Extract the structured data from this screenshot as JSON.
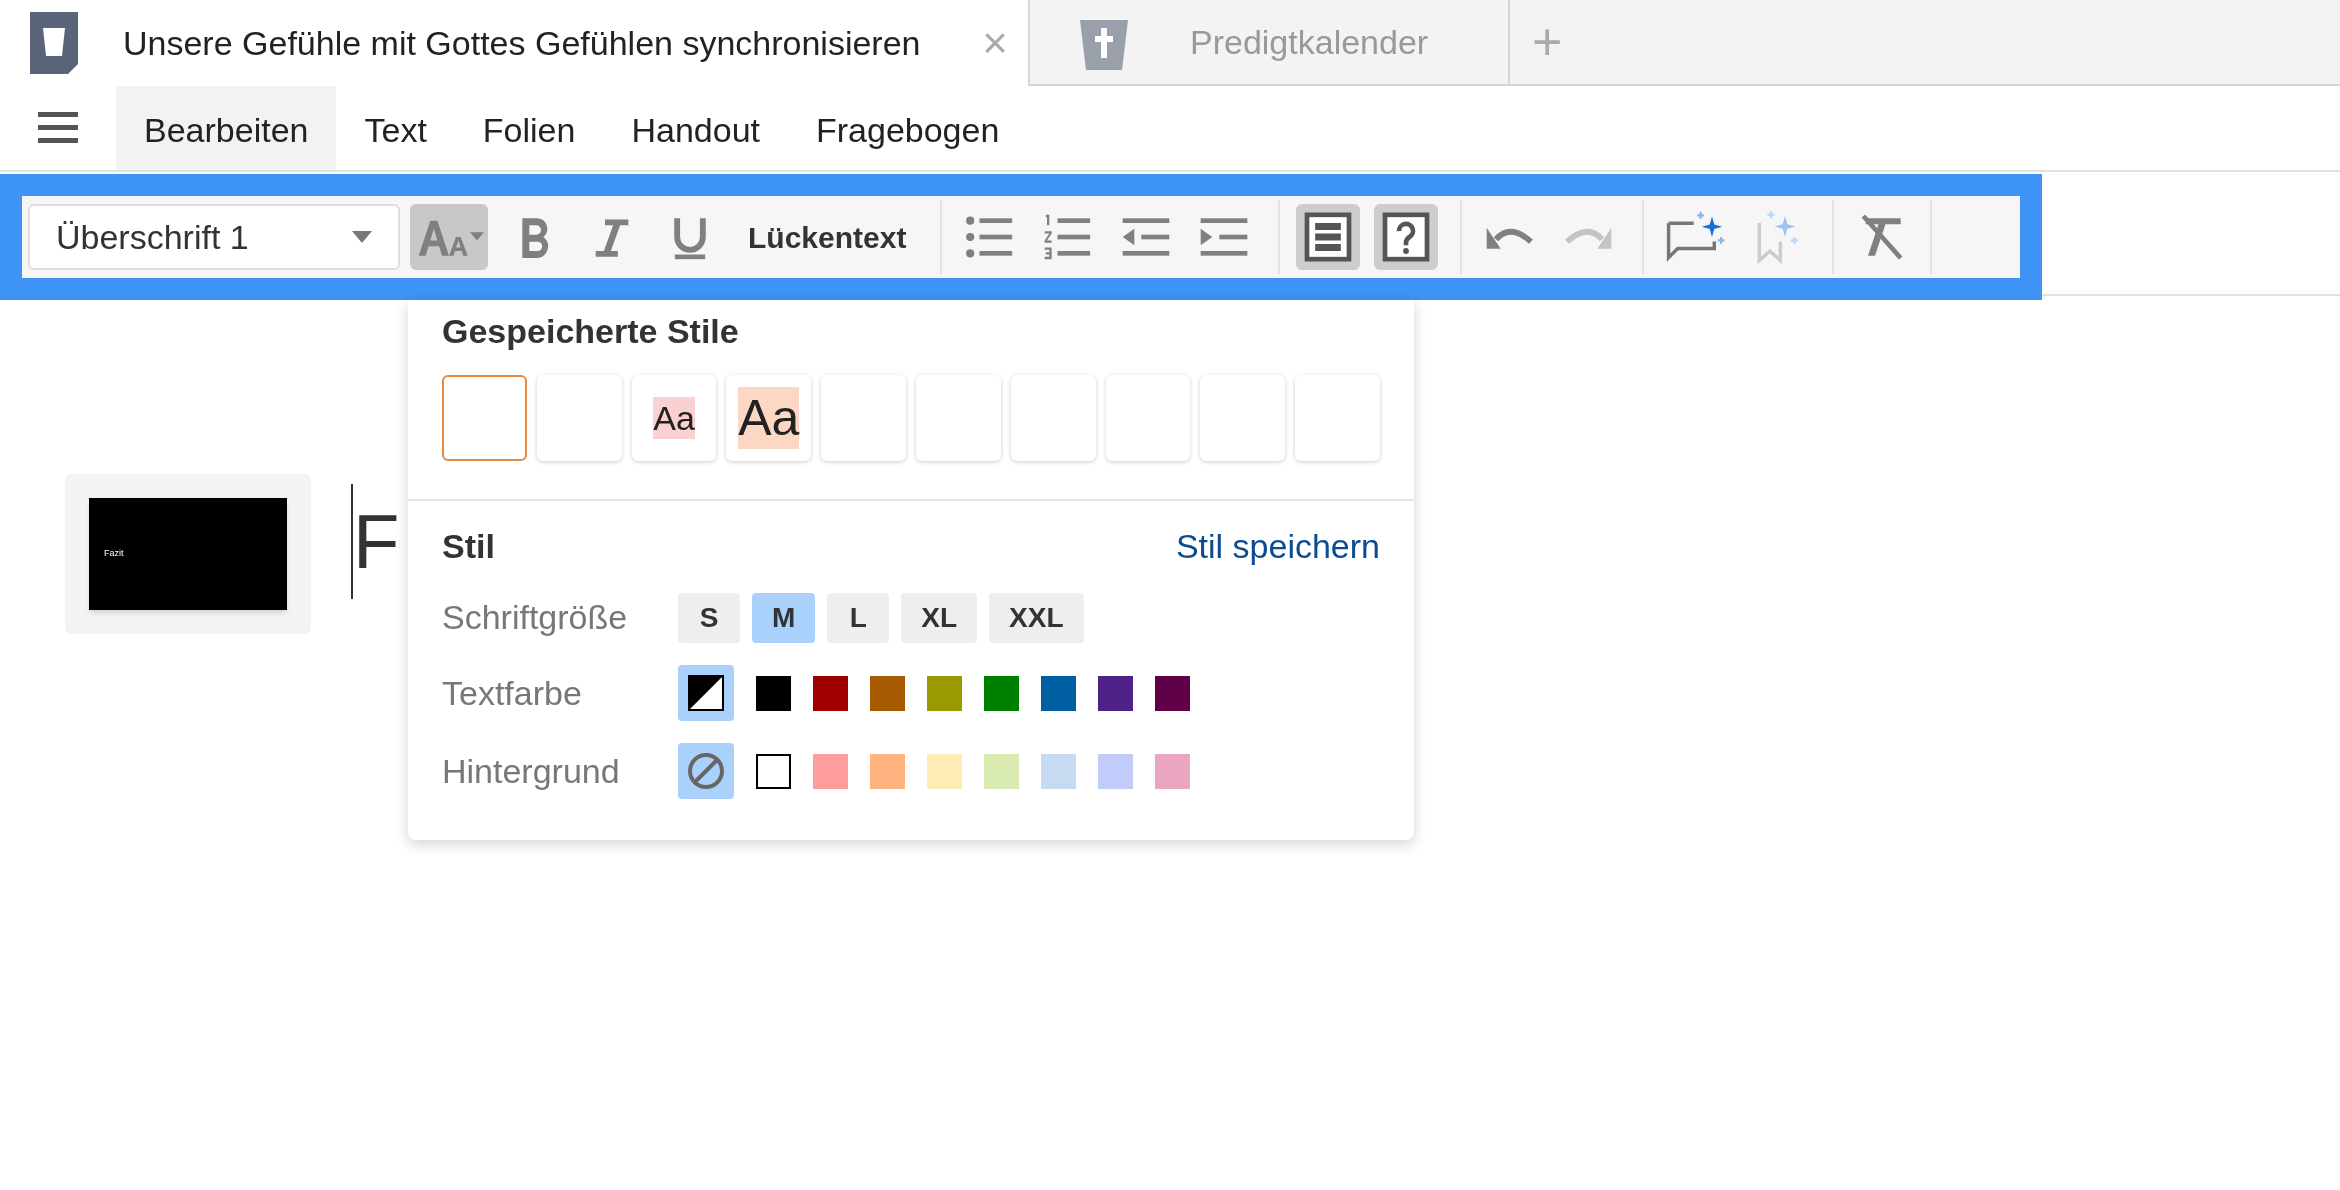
{
  "tabs": [
    {
      "title": "Unsere Gefühle mit Gottes Gefühlen synchronisieren",
      "selected": true,
      "close": "×"
    },
    {
      "title": "Predigtkalender",
      "selected": false
    }
  ],
  "new_tab": "+",
  "menu": [
    {
      "label": "Bearbeiten",
      "selected": true
    },
    {
      "label": "Text",
      "selected": false
    },
    {
      "label": "Folien",
      "selected": false
    },
    {
      "label": "Handout",
      "selected": false
    },
    {
      "label": "Fragebogen",
      "selected": false
    }
  ],
  "toolbar": {
    "paragraph_style": "Überschrift 1",
    "groups": [
      [
        {
          "kind": "font-size",
          "selected": true,
          "disabled": false
        },
        {
          "kind": "bold",
          "selected": false,
          "disabled": false
        },
        {
          "kind": "italic",
          "selected": false,
          "disabled": false
        },
        {
          "kind": "underline",
          "selected": false,
          "disabled": false
        },
        {
          "kind": "gap-text",
          "label": "Lückentext",
          "selected": false,
          "disabled": false
        }
      ],
      [
        {
          "kind": "bullet-list",
          "selected": false,
          "disabled": false
        },
        {
          "kind": "numbered-list",
          "selected": false,
          "disabled": false
        },
        {
          "kind": "outdent",
          "selected": false,
          "disabled": false
        },
        {
          "kind": "indent",
          "selected": false,
          "disabled": false
        }
      ],
      [
        {
          "kind": "text-block",
          "selected": true,
          "disabled": false
        },
        {
          "kind": "question-block",
          "selected": true,
          "disabled": false
        }
      ],
      [
        {
          "kind": "undo",
          "selected": false,
          "disabled": false
        },
        {
          "kind": "redo",
          "selected": false,
          "disabled": true
        }
      ],
      [
        {
          "kind": "ai-comment",
          "selected": false,
          "disabled": false
        },
        {
          "kind": "ai-bookmark",
          "selected": false,
          "disabled": true
        }
      ],
      [
        {
          "kind": "clear-format",
          "selected": false,
          "disabled": false
        }
      ]
    ]
  },
  "slides": [
    {
      "title": "Fazit",
      "selected": false
    }
  ],
  "editor_text": "F",
  "style_popup": {
    "saved_title": "Gespeicherte Stile",
    "saved_styles": [
      {
        "selected": true
      },
      {
        "selected": false
      },
      {
        "selected": false,
        "sample": "Aa",
        "kind": "small",
        "color": "#fbd0d0"
      },
      {
        "selected": false,
        "sample": "Aa",
        "kind": "large",
        "color": "#fcd8c4"
      },
      {
        "selected": false
      },
      {
        "selected": false
      },
      {
        "selected": false
      },
      {
        "selected": false
      },
      {
        "selected": false
      },
      {
        "selected": false
      }
    ],
    "style_title": "Stil",
    "save_link": "Stil speichern",
    "font_size_label": "Schriftgröße",
    "font_sizes": [
      {
        "label": "S",
        "selected": false
      },
      {
        "label": "M",
        "selected": true
      },
      {
        "label": "L",
        "selected": false
      },
      {
        "label": "XL",
        "selected": false
      },
      {
        "label": "XXL",
        "selected": false
      }
    ],
    "text_color_label": "Textfarbe",
    "text_colors": [
      {
        "kind": "auto",
        "selected": true
      },
      {
        "kind": "swatch",
        "color": "#000000",
        "selected": false
      },
      {
        "kind": "swatch",
        "color": "#a00000",
        "selected": false
      },
      {
        "kind": "swatch",
        "color": "#a65b00",
        "selected": false
      },
      {
        "kind": "swatch",
        "color": "#999900",
        "selected": false
      },
      {
        "kind": "swatch",
        "color": "#008000",
        "selected": false
      },
      {
        "kind": "swatch",
        "color": "#005fa3",
        "selected": false
      },
      {
        "kind": "swatch",
        "color": "#4f2287",
        "selected": false
      },
      {
        "kind": "swatch",
        "color": "#600048",
        "selected": false
      }
    ],
    "background_label": "Hintergrund",
    "backgrounds": [
      {
        "kind": "none",
        "selected": true
      },
      {
        "kind": "swatch",
        "color": "#ffffff",
        "selected": false
      },
      {
        "kind": "swatch",
        "color": "#ff9d9d",
        "selected": false
      },
      {
        "kind": "swatch",
        "color": "#ffb47f",
        "selected": false
      },
      {
        "kind": "swatch",
        "color": "#ffecb5",
        "selected": false
      },
      {
        "kind": "swatch",
        "color": "#d9ebb1",
        "selected": false
      },
      {
        "kind": "swatch",
        "color": "#c6dbf2",
        "selected": false
      },
      {
        "kind": "swatch",
        "color": "#c2ccfa",
        "selected": false
      },
      {
        "kind": "swatch",
        "color": "#eaa5c0",
        "selected": false
      }
    ]
  }
}
